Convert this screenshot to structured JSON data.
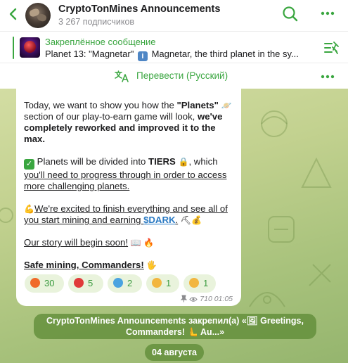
{
  "header": {
    "channel_title": "CryptoTonMines Announcements",
    "subscribers": "3 267 подписчиков",
    "avatar_icon": "mines-avatar-icon",
    "back_icon": "chevron-left-icon",
    "search_icon": "search-icon",
    "menu_icon": "more-dots-icon"
  },
  "pinned": {
    "label": "Закреплённое сообщение",
    "text_prefix": "Planet 13: \"Magnetar\"",
    "info_glyph": "i",
    "text_suffix": "Magnetar, the third planet in the sy...",
    "list_icon": "pinned-list-icon"
  },
  "translate": {
    "label": "Перевести (Русский)",
    "icon": "translate-icon"
  },
  "message": {
    "p1_a": "Today, we want to show you how the ",
    "p1_b": "\"Planets\"",
    "p1_c": " section of our play-to-earn game will look, ",
    "p1_d": "we've completely reworked and improved it to the max.",
    "p2_check": "✓",
    "p2_a": " Planets will be divided into ",
    "p2_b": "TIERS",
    "p2_c": ", which ",
    "p2_d": "you'll need to progress through in order to access more challenging planets.",
    "p3_a": "We're excited to finish everything and see all of you start mining and earning ",
    "p3_link": "$DARK",
    "p3_b": ".",
    "p4": "Our story will begin soon!",
    "p5": "Safe mining, Commanders!",
    "saturn_emoji": "🪐",
    "lock_emoji": "🔒",
    "muscle_emoji": "💪",
    "pick_emoji": "⛏",
    "bag_emoji": "💰",
    "book_emoji": "📖",
    "fire_emoji": "🔥",
    "wave_emoji": "🖐"
  },
  "reactions": [
    {
      "emoji": "fire-reaction-icon",
      "color": "#f06a2a",
      "count": "30"
    },
    {
      "emoji": "heart-reaction-icon",
      "color": "#e03a3a",
      "count": "5"
    },
    {
      "emoji": "whale-reaction-icon",
      "color": "#4aa3e0",
      "count": "2"
    },
    {
      "emoji": "thumbs-up-reaction-icon",
      "color": "#f2b640",
      "count": "1"
    },
    {
      "emoji": "ok-hand-reaction-icon",
      "color": "#f2b640",
      "count": "1"
    }
  ],
  "meta": {
    "views": "710",
    "time": "01:05"
  },
  "service_message": {
    "line1": "CryptoTonMines Announcements закрепил(а) «🖼 Greetings,",
    "line2": "Commanders! 🫷 Au...»"
  },
  "date_label": "04 августа",
  "colors": {
    "accent_green": "#3aa640",
    "link_blue": "#2a7ac3",
    "pill_green": "#5f8c37"
  }
}
